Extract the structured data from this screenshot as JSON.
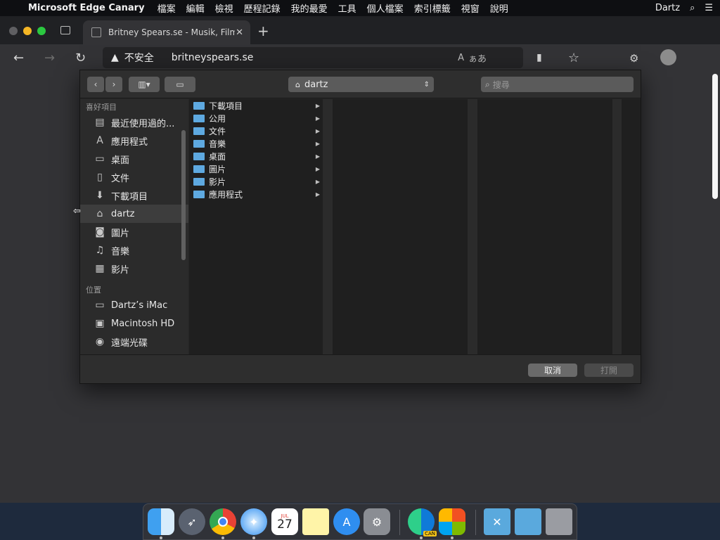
{
  "menubar": {
    "apple": "",
    "app_name": "Microsoft Edge Canary",
    "items": [
      "檔案",
      "編輯",
      "檢視",
      "歷程記錄",
      "我的最愛",
      "工具",
      "個人檔案",
      "索引標籤",
      "視窗",
      "說明"
    ],
    "user": "Dartz",
    "search_icon": "⌕",
    "list_icon": "☰"
  },
  "tab": {
    "title": "Britney Spears.se - Musik, Film",
    "close": "✕",
    "new_tab": "+"
  },
  "toolbar": {
    "back": "←",
    "forward": "→",
    "reload": "↻",
    "warning": "▲",
    "insecure_label": "不安全",
    "url": "britneyspears.se",
    "read_aloud": "A",
    "translate": "ぁあ",
    "sidebar": "▮",
    "favorites": "☆",
    "extensions": "⚙"
  },
  "dialog": {
    "nav_back": "‹",
    "nav_forward": "›",
    "view_mode": "▥▾",
    "new_folder": "▭",
    "path": "dartz",
    "path_arrows": "⇕",
    "search_placeholder": "搜尋",
    "sidebar": {
      "favorites_heading": "喜好項目",
      "favorites": [
        {
          "label": "最近使用過的...",
          "icon": "▤"
        },
        {
          "label": "應用程式",
          "icon": "A"
        },
        {
          "label": "桌面",
          "icon": "▭"
        },
        {
          "label": "文件",
          "icon": "▯"
        },
        {
          "label": "下載項目",
          "icon": "⬇"
        },
        {
          "label": "dartz",
          "icon": "⌂"
        },
        {
          "label": "圖片",
          "icon": "◙"
        },
        {
          "label": "音樂",
          "icon": "♫"
        },
        {
          "label": "影片",
          "icon": "▦"
        }
      ],
      "locations_heading": "位置",
      "locations": [
        {
          "label": "Dartz’s iMac",
          "icon": "▭"
        },
        {
          "label": "Macintosh HD",
          "icon": "▣"
        },
        {
          "label": "遠端光碟",
          "icon": "◉"
        }
      ]
    },
    "files": [
      "下載項目",
      "公用",
      "文件",
      "音樂",
      "桌面",
      "圖片",
      "影片",
      "應用程式"
    ],
    "cancel": "取消",
    "open": "打開"
  },
  "dock": {
    "calendar_day": "27",
    "calendar_month": "JUL",
    "can_badge": "CAN"
  }
}
